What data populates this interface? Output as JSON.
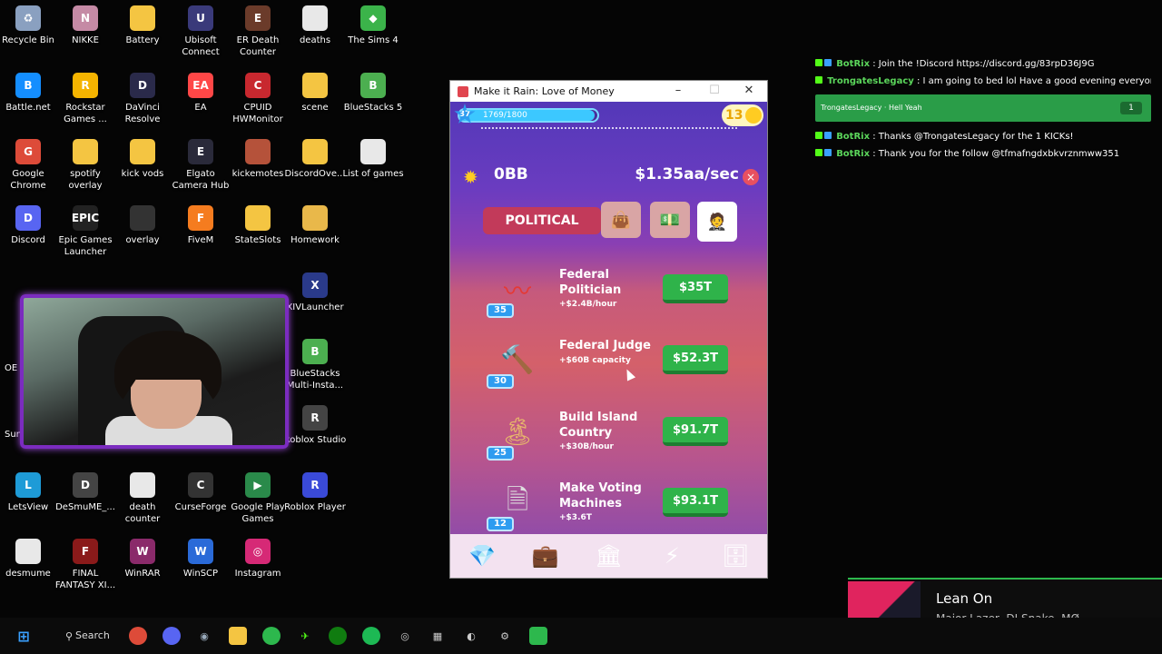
{
  "desktop": {
    "icons": [
      {
        "label": "Recycle Bin",
        "glyph": "♻",
        "color": "#8aa0c0"
      },
      {
        "label": "NIKKE",
        "glyph": "N",
        "color": "#c58aa5"
      },
      {
        "label": "Battery",
        "glyph": "",
        "color": "#f4c542"
      },
      {
        "label": "Ubisoft Connect",
        "glyph": "U",
        "color": "#3a3a7a"
      },
      {
        "label": "ER Death Counter",
        "glyph": "E",
        "color": "#6b3b2a"
      },
      {
        "label": "deaths",
        "glyph": "",
        "color": "#e8e8e8"
      },
      {
        "label": "The Sims 4",
        "glyph": "◆",
        "color": "#3bb34a"
      },
      {
        "label": "Battle.net",
        "glyph": "B",
        "color": "#148eff"
      },
      {
        "label": "Rockstar Games ...",
        "glyph": "R",
        "color": "#f5b400"
      },
      {
        "label": "DaVinci Resolve",
        "glyph": "D",
        "color": "#2a2a4a"
      },
      {
        "label": "EA",
        "glyph": "EA",
        "color": "#ff4747"
      },
      {
        "label": "CPUID HWMonitor",
        "glyph": "C",
        "color": "#c8282f"
      },
      {
        "label": "scene",
        "glyph": "",
        "color": "#f4c542"
      },
      {
        "label": "BlueStacks 5",
        "glyph": "B",
        "color": "#4caf50"
      },
      {
        "label": "Google Chrome",
        "glyph": "G",
        "color": "#dd4b39"
      },
      {
        "label": "spotify overlay",
        "glyph": "",
        "color": "#f4c542"
      },
      {
        "label": "kick vods",
        "glyph": "",
        "color": "#f4c542"
      },
      {
        "label": "Elgato Camera Hub",
        "glyph": "E",
        "color": "#2a2a3a"
      },
      {
        "label": "kickemotes",
        "glyph": "",
        "color": "#b5523a"
      },
      {
        "label": "DiscordOve...",
        "glyph": "",
        "color": "#f4c542"
      },
      {
        "label": "List of games",
        "glyph": "",
        "color": "#e8e8e8"
      },
      {
        "label": "Discord",
        "glyph": "D",
        "color": "#5865f2"
      },
      {
        "label": "Epic Games Launcher",
        "glyph": "EPIC",
        "color": "#222"
      },
      {
        "label": "overlay",
        "glyph": "",
        "color": "#333"
      },
      {
        "label": "FiveM",
        "glyph": "F",
        "color": "#f57c1f"
      },
      {
        "label": "StateSlots",
        "glyph": "",
        "color": "#f4c542"
      },
      {
        "label": "Homework",
        "glyph": "",
        "color": "#e9b84a"
      },
      {
        "label": "XIVLauncher",
        "glyph": "X",
        "color": "#2a3a8a"
      },
      {
        "label": "BlueStacks Multi-Insta...",
        "glyph": "B",
        "color": "#4caf50"
      },
      {
        "label": "Roblox Studio",
        "glyph": "R",
        "color": "#444"
      },
      {
        "label": "LetsView",
        "glyph": "L",
        "color": "#1e9bd7"
      },
      {
        "label": "DeSmuME_...",
        "glyph": "D",
        "color": "#444"
      },
      {
        "label": "death counter",
        "glyph": "",
        "color": "#e8e8e8"
      },
      {
        "label": "CurseForge",
        "glyph": "C",
        "color": "#333"
      },
      {
        "label": "Google Play Games",
        "glyph": "▶",
        "color": "#2a8a4a"
      },
      {
        "label": "Roblox Player",
        "glyph": "R",
        "color": "#3a4ad8"
      },
      {
        "label": "desmume",
        "glyph": "",
        "color": "#e8e8e8"
      },
      {
        "label": "FINAL FANTASY XI...",
        "glyph": "F",
        "color": "#8a1a1a"
      },
      {
        "label": "WinRAR",
        "glyph": "W",
        "color": "#8a2a6a"
      },
      {
        "label": "WinSCP",
        "glyph": "W",
        "color": "#2a6ad8"
      },
      {
        "label": "Instagram",
        "glyph": "◎",
        "color": "#d62976"
      }
    ],
    "partial_labels": [
      "OE",
      "Sun"
    ]
  },
  "game_window": {
    "title": "Make it Rain: Love of Money",
    "level": "37",
    "xp_text": "1769/1800",
    "xp_fraction": 0.98,
    "coins": "13",
    "money": "0BB",
    "rate": "$1.35aa/sec",
    "category": "POLITICAL",
    "items": [
      {
        "name": "Federal Politician",
        "sub": "+$2.4B/hour",
        "level": "35",
        "price": "$35T",
        "art": "〰",
        "art_color": "#e53935"
      },
      {
        "name": "Federal Judge",
        "sub": "+$60B capacity",
        "level": "30",
        "price": "$52.3T",
        "art": "🔨",
        "art_color": "#b07a3a"
      },
      {
        "name": "Build Island Country",
        "sub": "+$30B/hour",
        "level": "25",
        "price": "$91.7T",
        "art": "🏝",
        "art_color": "#e8b86a"
      },
      {
        "name": "Make Voting Machines",
        "sub": "+$3.6T",
        "level": "12",
        "price": "$93.1T",
        "art": "🗎",
        "art_color": "#ddd"
      }
    ]
  },
  "chat": {
    "messages": [
      {
        "user": "BotRix",
        "text": " : Join the !Discord https://discord.gg/83rpD36J9G"
      },
      {
        "user": "TrongatesLegacy",
        "text": " : I am going to bed lol Have a good evening everyone"
      },
      {
        "user": "BotRix",
        "text": " : Thanks @TrongatesLegacy for the 1 KICKs!"
      },
      {
        "user": "BotRix",
        "text": " : Thank you for the follow @tfmafngdxbkvrznmww351"
      }
    ],
    "highlight": {
      "user": "TrongatesLegacy",
      "text": " · Hell Yeah",
      "count": "1"
    }
  },
  "now_playing": {
    "song": "Lean On",
    "artist": "Major Lazer, DJ Snake, MØ",
    "progress": 0.2
  },
  "taskbar": {
    "search_label": "Search"
  }
}
